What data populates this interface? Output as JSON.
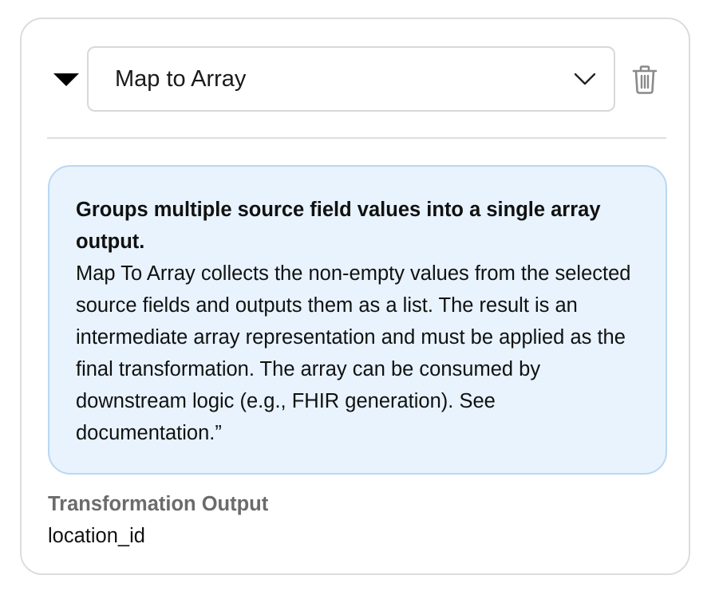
{
  "transformation": {
    "selected_type": "Map to Array",
    "expanded": true
  },
  "icons": {
    "collapse": "caret-down-icon",
    "dropdown": "chevron-down-icon",
    "delete": "trash-icon"
  },
  "description": {
    "title": "Groups multiple source field values into a single array output.",
    "body": "Map To Array collects the non-empty values from the selected source fields and outputs them as a list. The result is an intermediate array representation and must be applied as the final transformation. The array can be consumed by downstream logic (e.g., FHIR generation). See documentation.”"
  },
  "output": {
    "label": "Transformation Output",
    "value": "location_id"
  },
  "colors": {
    "info_background": "#e8f3fd",
    "info_border": "#b9d8f3",
    "label_gray": "#6b6b6b",
    "icon_gray": "#8a8a8a"
  }
}
